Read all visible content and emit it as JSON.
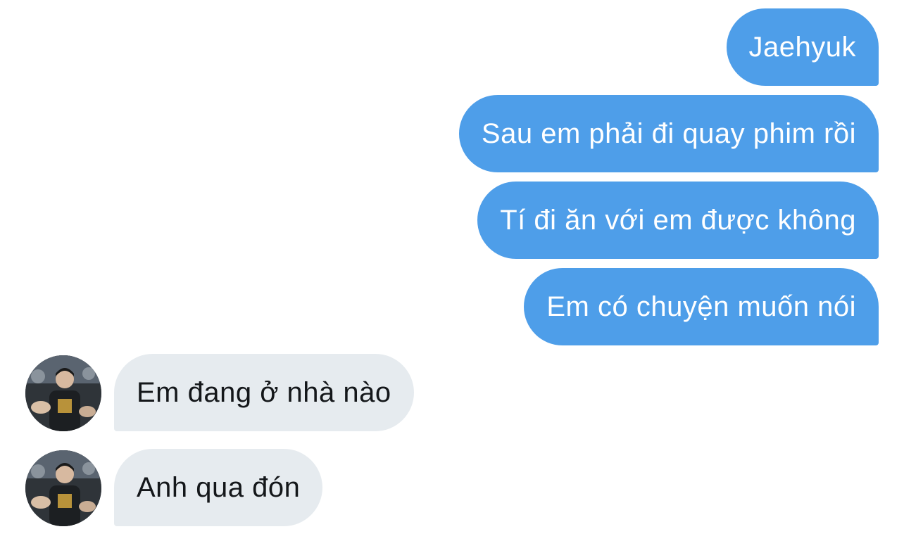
{
  "messages": {
    "outgoing": [
      {
        "text": "Jaehyuk"
      },
      {
        "text": "Sau em phải đi quay phim rồi"
      },
      {
        "text": "Tí đi ăn với em được không"
      },
      {
        "text": "Em có chuyện muốn nói"
      }
    ],
    "incoming": [
      {
        "text": "Em đang ở nhà nào",
        "avatar": "user-avatar"
      },
      {
        "text": "Anh qua đón",
        "avatar": "user-avatar"
      }
    ]
  },
  "colors": {
    "outgoing_bubble": "#4e9ee9",
    "incoming_bubble": "#e6ebef",
    "incoming_text": "#14171a"
  }
}
